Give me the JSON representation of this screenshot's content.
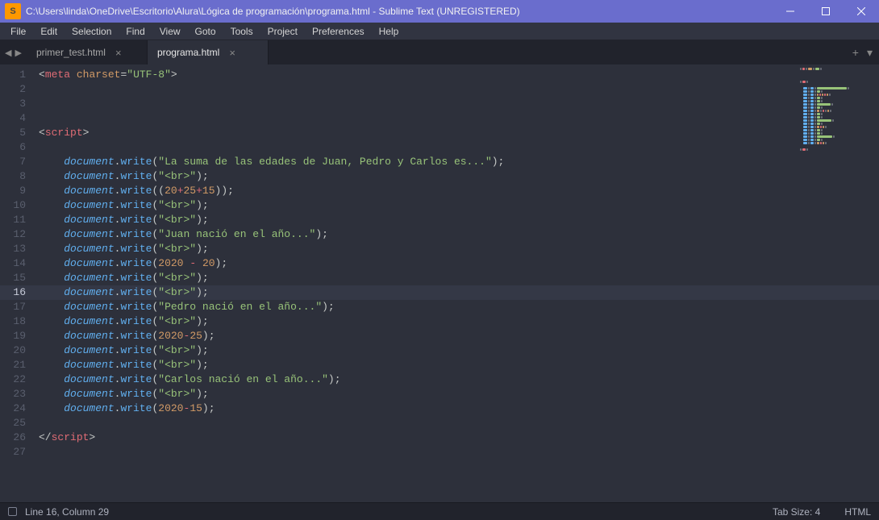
{
  "window": {
    "title": "C:\\Users\\linda\\OneDrive\\Escritorio\\Alura\\Lógica de programación\\programa.html - Sublime Text (UNREGISTERED)",
    "app_icon_letter": "S"
  },
  "menu": {
    "items": [
      "File",
      "Edit",
      "Selection",
      "Find",
      "View",
      "Goto",
      "Tools",
      "Project",
      "Preferences",
      "Help"
    ]
  },
  "tabs": [
    {
      "label": "primer_test.html",
      "active": false
    },
    {
      "label": "programa.html",
      "active": true
    }
  ],
  "status": {
    "cursor": "Line 16, Column 29",
    "tab_size": "Tab Size: 4",
    "syntax": "HTML"
  },
  "editor": {
    "current_line": 16,
    "lines": [
      {
        "n": 1,
        "tokens": [
          [
            "p",
            "<"
          ],
          [
            "tg",
            "meta"
          ],
          [
            "p",
            " "
          ],
          [
            "at",
            "charset"
          ],
          [
            "eq",
            "="
          ],
          [
            "st",
            "\"UTF-8\""
          ],
          [
            "p",
            ">"
          ]
        ]
      },
      {
        "n": 2,
        "tokens": []
      },
      {
        "n": 3,
        "tokens": []
      },
      {
        "n": 4,
        "tokens": []
      },
      {
        "n": 5,
        "tokens": [
          [
            "p",
            "<"
          ],
          [
            "tg",
            "script"
          ],
          [
            "p",
            ">"
          ]
        ]
      },
      {
        "n": 6,
        "tokens": []
      },
      {
        "n": 7,
        "indent": 4,
        "tokens": [
          [
            "ob",
            "document"
          ],
          [
            "p",
            "."
          ],
          [
            "fn",
            "write"
          ],
          [
            "p",
            "("
          ],
          [
            "st",
            "\"La suma de las edades de Juan, Pedro y Carlos es...\""
          ],
          [
            "p",
            ");"
          ]
        ]
      },
      {
        "n": 8,
        "indent": 4,
        "tokens": [
          [
            "ob",
            "document"
          ],
          [
            "p",
            "."
          ],
          [
            "fn",
            "write"
          ],
          [
            "p",
            "("
          ],
          [
            "st",
            "\"<br>\""
          ],
          [
            "p",
            ");"
          ]
        ]
      },
      {
        "n": 9,
        "indent": 4,
        "tokens": [
          [
            "ob",
            "document"
          ],
          [
            "p",
            "."
          ],
          [
            "fn",
            "write"
          ],
          [
            "p",
            "(("
          ],
          [
            "nm",
            "20"
          ],
          [
            "op",
            "+"
          ],
          [
            "nm",
            "25"
          ],
          [
            "op",
            "+"
          ],
          [
            "nm",
            "15"
          ],
          [
            "p",
            "));"
          ]
        ]
      },
      {
        "n": 10,
        "indent": 4,
        "tokens": [
          [
            "ob",
            "document"
          ],
          [
            "p",
            "."
          ],
          [
            "fn",
            "write"
          ],
          [
            "p",
            "("
          ],
          [
            "st",
            "\"<br>\""
          ],
          [
            "p",
            ");"
          ]
        ]
      },
      {
        "n": 11,
        "indent": 4,
        "tokens": [
          [
            "ob",
            "document"
          ],
          [
            "p",
            "."
          ],
          [
            "fn",
            "write"
          ],
          [
            "p",
            "("
          ],
          [
            "st",
            "\"<br>\""
          ],
          [
            "p",
            ");"
          ]
        ]
      },
      {
        "n": 12,
        "indent": 4,
        "tokens": [
          [
            "ob",
            "document"
          ],
          [
            "p",
            "."
          ],
          [
            "fn",
            "write"
          ],
          [
            "p",
            "("
          ],
          [
            "st",
            "\"Juan nació en el año...\""
          ],
          [
            "p",
            ");"
          ]
        ]
      },
      {
        "n": 13,
        "indent": 4,
        "tokens": [
          [
            "ob",
            "document"
          ],
          [
            "p",
            "."
          ],
          [
            "fn",
            "write"
          ],
          [
            "p",
            "("
          ],
          [
            "st",
            "\"<br>\""
          ],
          [
            "p",
            ");"
          ]
        ]
      },
      {
        "n": 14,
        "indent": 4,
        "tokens": [
          [
            "ob",
            "document"
          ],
          [
            "p",
            "."
          ],
          [
            "fn",
            "write"
          ],
          [
            "p",
            "("
          ],
          [
            "nm",
            "2020"
          ],
          [
            "p",
            " "
          ],
          [
            "op",
            "-"
          ],
          [
            "p",
            " "
          ],
          [
            "nm",
            "20"
          ],
          [
            "p",
            ");"
          ]
        ]
      },
      {
        "n": 15,
        "indent": 4,
        "tokens": [
          [
            "ob",
            "document"
          ],
          [
            "p",
            "."
          ],
          [
            "fn",
            "write"
          ],
          [
            "p",
            "("
          ],
          [
            "st",
            "\"<br>\""
          ],
          [
            "p",
            ");"
          ]
        ]
      },
      {
        "n": 16,
        "indent": 4,
        "tokens": [
          [
            "ob",
            "document"
          ],
          [
            "p",
            "."
          ],
          [
            "fn",
            "write"
          ],
          [
            "p",
            "("
          ],
          [
            "st",
            "\"<br>\""
          ],
          [
            "p",
            ");"
          ]
        ],
        "caret_after": true
      },
      {
        "n": 17,
        "indent": 4,
        "tokens": [
          [
            "ob",
            "document"
          ],
          [
            "p",
            "."
          ],
          [
            "fn",
            "write"
          ],
          [
            "p",
            "("
          ],
          [
            "st",
            "\"Pedro nació en el año...\""
          ],
          [
            "p",
            ");"
          ]
        ]
      },
      {
        "n": 18,
        "indent": 4,
        "tokens": [
          [
            "ob",
            "document"
          ],
          [
            "p",
            "."
          ],
          [
            "fn",
            "write"
          ],
          [
            "p",
            "("
          ],
          [
            "st",
            "\"<br>\""
          ],
          [
            "p",
            ");"
          ]
        ]
      },
      {
        "n": 19,
        "indent": 4,
        "tokens": [
          [
            "ob",
            "document"
          ],
          [
            "p",
            "."
          ],
          [
            "fn",
            "write"
          ],
          [
            "p",
            "("
          ],
          [
            "nm",
            "2020"
          ],
          [
            "op",
            "-"
          ],
          [
            "nm",
            "25"
          ],
          [
            "p",
            ");"
          ]
        ]
      },
      {
        "n": 20,
        "indent": 4,
        "tokens": [
          [
            "ob",
            "document"
          ],
          [
            "p",
            "."
          ],
          [
            "fn",
            "write"
          ],
          [
            "p",
            "("
          ],
          [
            "st",
            "\"<br>\""
          ],
          [
            "p",
            ");"
          ]
        ]
      },
      {
        "n": 21,
        "indent": 4,
        "tokens": [
          [
            "ob",
            "document"
          ],
          [
            "p",
            "."
          ],
          [
            "fn",
            "write"
          ],
          [
            "p",
            "("
          ],
          [
            "st",
            "\"<br>\""
          ],
          [
            "p",
            ");"
          ]
        ]
      },
      {
        "n": 22,
        "indent": 4,
        "tokens": [
          [
            "ob",
            "document"
          ],
          [
            "p",
            "."
          ],
          [
            "fn",
            "write"
          ],
          [
            "p",
            "("
          ],
          [
            "st",
            "\"Carlos nació en el año...\""
          ],
          [
            "p",
            ");"
          ]
        ]
      },
      {
        "n": 23,
        "indent": 4,
        "tokens": [
          [
            "ob",
            "document"
          ],
          [
            "p",
            "."
          ],
          [
            "fn",
            "write"
          ],
          [
            "p",
            "("
          ],
          [
            "st",
            "\"<br>\""
          ],
          [
            "p",
            ");"
          ]
        ]
      },
      {
        "n": 24,
        "indent": 4,
        "tokens": [
          [
            "ob",
            "document"
          ],
          [
            "p",
            "."
          ],
          [
            "fn",
            "write"
          ],
          [
            "p",
            "("
          ],
          [
            "nm",
            "2020"
          ],
          [
            "op",
            "-"
          ],
          [
            "nm",
            "15"
          ],
          [
            "p",
            ");"
          ]
        ]
      },
      {
        "n": 25,
        "tokens": []
      },
      {
        "n": 26,
        "tokens": [
          [
            "p",
            "</"
          ],
          [
            "tg",
            "script"
          ],
          [
            "p",
            ">"
          ]
        ]
      },
      {
        "n": 27,
        "tokens": []
      }
    ]
  }
}
